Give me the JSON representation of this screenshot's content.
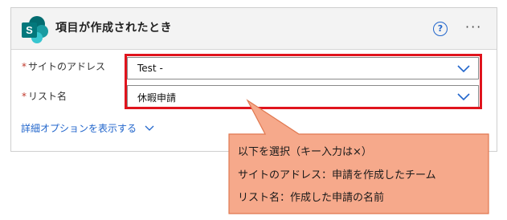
{
  "card": {
    "title": "項目が作成されたとき",
    "help_symbol": "?",
    "more_symbol": "···",
    "logo_letter": "S"
  },
  "fields": [
    {
      "required_mark": "*",
      "label": "サイトのアドレス",
      "value": "Test -"
    },
    {
      "required_mark": "*",
      "label": "リスト名",
      "value": "休暇申請"
    }
  ],
  "advanced_link": "詳細オプションを表示する",
  "callout": {
    "lines": [
      "以下を選択（キー入力は×）",
      "サイトのアドレス：申請を作成したチーム",
      "リスト名：作成した申請の名前"
    ]
  },
  "colors": {
    "accent": "#2266cc",
    "highlight_border": "#e0141d",
    "callout_fill": "#f6a98b",
    "callout_border": "#e07850",
    "sharepoint_teal": "#038387"
  },
  "icons": [
    "sharepoint-logo-icon",
    "help-icon",
    "more-icon",
    "chevron-down-icon"
  ]
}
